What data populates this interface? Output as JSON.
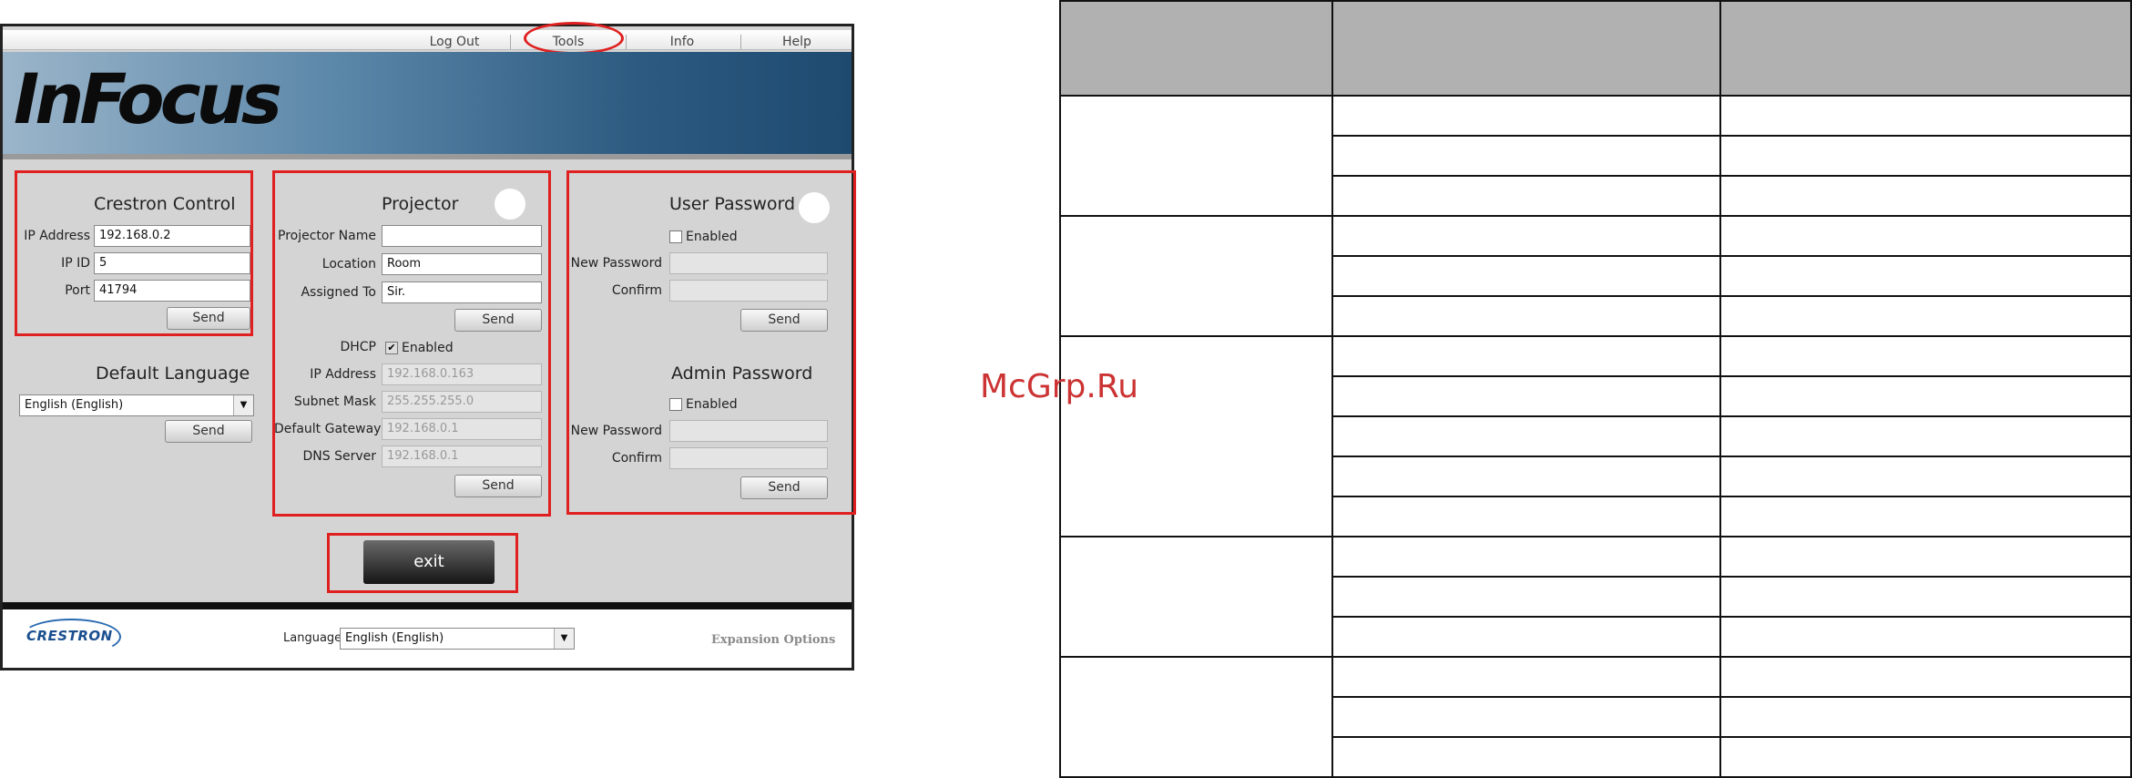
{
  "top_nav": {
    "items": [
      "Log Out",
      "Tools",
      "Info",
      "Help"
    ]
  },
  "banner": {
    "logo_text": "InFocus"
  },
  "crestron_control": {
    "title": "Crestron Control",
    "ip_address_label": "IP Address",
    "ip_address_value": "192.168.0.2",
    "ip_id_label": "IP ID",
    "ip_id_value": "5",
    "port_label": "Port",
    "port_value": "41794",
    "send_label": "Send"
  },
  "default_language": {
    "title": "Default Language",
    "selected": "English (English)",
    "send_label": "Send"
  },
  "projector": {
    "title": "Projector",
    "name_label": "Projector Name",
    "name_value": "",
    "location_label": "Location",
    "location_value": "Room",
    "assigned_label": "Assigned To",
    "assigned_value": "Sir.",
    "send_label": "Send",
    "dhcp_label": "DHCP",
    "dhcp_enabled_label": "Enabled",
    "dhcp_checked": true,
    "ip_label": "IP Address",
    "ip_value": "192.168.0.163",
    "subnet_label": "Subnet Mask",
    "subnet_value": "255.255.255.0",
    "gateway_label": "Default Gateway",
    "gateway_value": "192.168.0.1",
    "dns_label": "DNS Server",
    "dns_value": "192.168.0.1",
    "send2_label": "Send"
  },
  "user_password": {
    "title": "User Password",
    "enabled_label": "Enabled",
    "new_label": "New Password",
    "confirm_label": "Confirm",
    "send_label": "Send"
  },
  "admin_password": {
    "title": "Admin Password",
    "enabled_label": "Enabled",
    "new_label": "New Password",
    "confirm_label": "Confirm",
    "send_label": "Send"
  },
  "exit_label": "exit",
  "footer": {
    "brand": "CRESTRON",
    "language_label": "Language",
    "language_value": "English (English)",
    "expansion": "Expansion Options"
  },
  "watermark": "McGrp.Ru",
  "colors": {
    "highlight": "#e02020",
    "banner": "#2c5a80"
  }
}
